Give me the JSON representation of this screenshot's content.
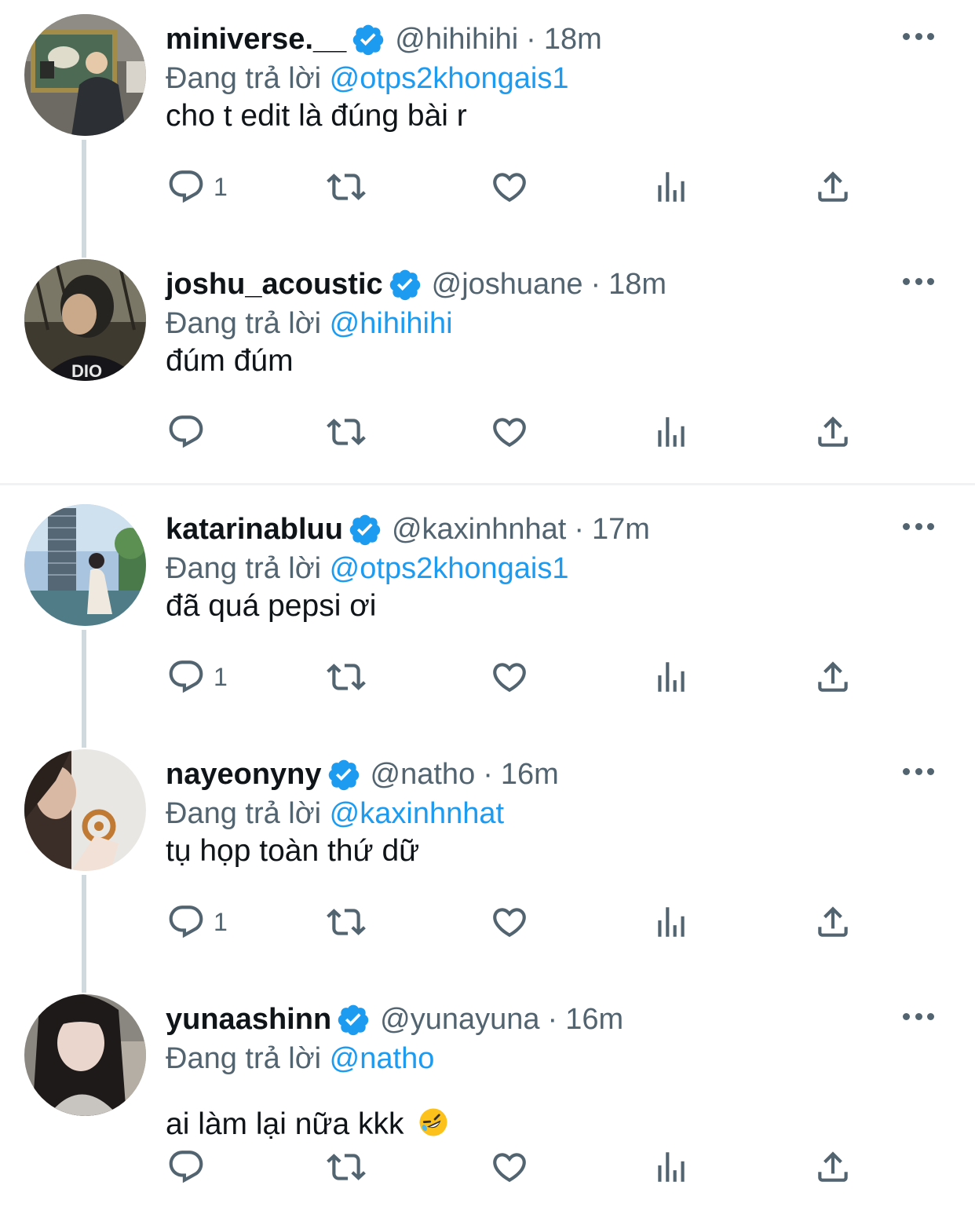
{
  "reply_prefix": "Đang trả lời",
  "colors": {
    "accent": "#1d9bf0",
    "muted": "#536471",
    "text": "#0f1419",
    "divider": "#eff3f4"
  },
  "icons": {
    "reply": "reply-bubble-icon",
    "retweet": "retweet-icon",
    "like": "heart-icon",
    "views": "views-bar-chart-icon",
    "share": "share-upload-icon",
    "verified": "verified-badge-icon",
    "more": "more-dots-icon"
  },
  "tweets": [
    {
      "name": "miniverse.__",
      "handle": "@hihihihi",
      "time": "18m",
      "reply_to": "@otps2khongais1",
      "text": "cho t edit là đúng bài r",
      "reply_count": "1"
    },
    {
      "name": "joshu_acoustic",
      "handle": "@joshuane",
      "time": "18m",
      "reply_to": "@hihihihi",
      "text": "đúm đúm",
      "reply_count": ""
    },
    {
      "name": "katarinabluu",
      "handle": "@kaxinhnhat",
      "time": "17m",
      "reply_to": "@otps2khongais1",
      "text": "đã quá pepsi ơi",
      "reply_count": "1"
    },
    {
      "name": "nayeonyny",
      "handle": "@natho",
      "time": "16m",
      "reply_to": "@kaxinhnhat",
      "text": "tụ họp toàn thứ dữ",
      "reply_count": "1"
    },
    {
      "name": "yunaashinn",
      "handle": "@yunayuna",
      "time": "16m",
      "reply_to": "@natho",
      "text": "ai làm lại nữa kkk",
      "reply_count": ""
    }
  ]
}
